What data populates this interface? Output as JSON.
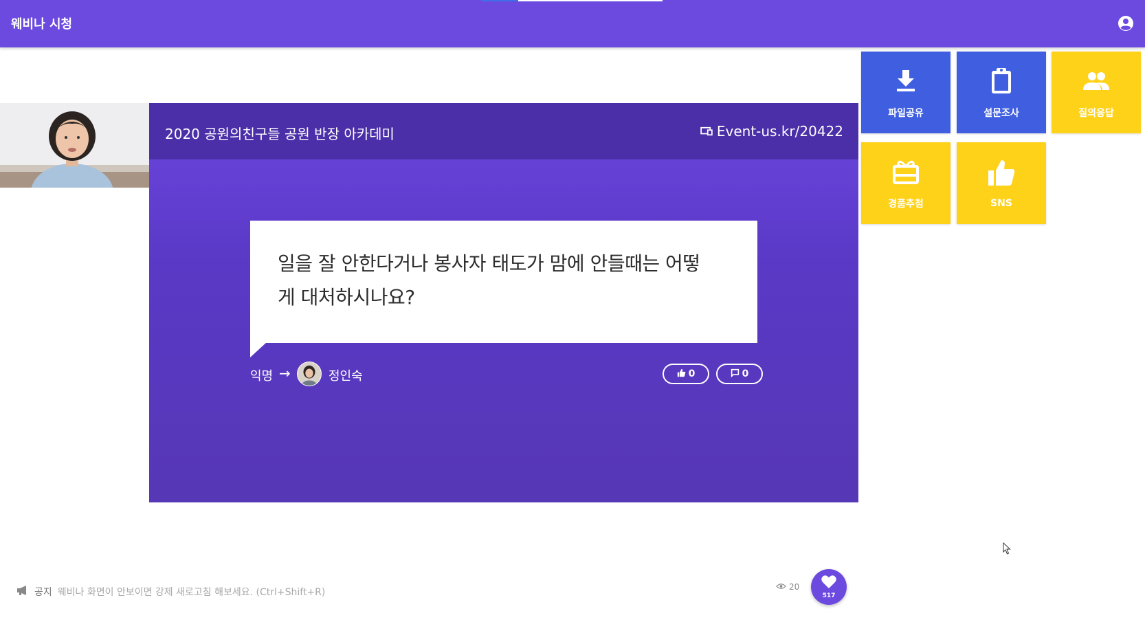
{
  "app": {
    "title": "웨비나 시청"
  },
  "colors": {
    "primary": "#6c4ae0",
    "stage_header": "#4b2fa8",
    "tile_blue": "#3f5fe0",
    "tile_yellow": "#ffd21a"
  },
  "stage": {
    "title": "2020 공원의친구들 공원 반장 아카데미",
    "link": "Event-us.kr/20422",
    "link_icon": "screen-icon"
  },
  "question": {
    "text_line1": "일을 잘 안한다거나 봉사자 태도가 맘에 안들때는 어떻",
    "text_line2": "게 대처하시나요?",
    "from": "익명",
    "arrow": "→",
    "to": "정인숙",
    "likes": "0",
    "comments": "0"
  },
  "tiles": [
    {
      "label": "파일공유",
      "icon": "download-icon"
    },
    {
      "label": "설문조사",
      "icon": "clipboard-icon"
    },
    {
      "label": "질의응답",
      "icon": "people-icon"
    },
    {
      "label": "경품추첨",
      "icon": "gift-icon"
    },
    {
      "label": "SNS",
      "icon": "thumbs-up-icon"
    }
  ],
  "footer": {
    "notice_label": "공지",
    "notice_text": "웨비나 화면이 안보이면 강제 새로고침 해보세요. (Ctrl+Shift+R)",
    "views": "20",
    "hearts": "517"
  }
}
